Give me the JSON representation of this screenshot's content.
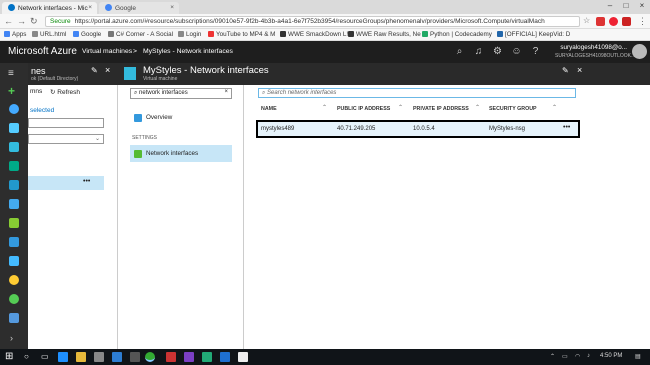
{
  "browser": {
    "tabs": [
      {
        "label": "Network interfaces - Mic",
        "active": true
      },
      {
        "label": "Google",
        "active": false
      }
    ],
    "secure_label": "Secure",
    "url": "https://portal.azure.com/#resource/subscriptions/09010e57-9f2b-4b3b-a4a1-6e7f752b3954/resourceGroups/phenomenalv/providers/Microsoft.Compute/virtualMach",
    "bookmarks": [
      "Apps",
      "URL.html",
      "Google",
      "C# Corner - A Social",
      "Login",
      "YouTube to MP4 & M",
      "WWE SmackDown L!",
      "WWE Raw Results, Ne",
      "Python | Codecademy",
      "[OFFICIAL] KeepVid: D"
    ]
  },
  "azure": {
    "logo": "Microsoft Azure",
    "breadcrumb": [
      "Virtual machines",
      ">",
      "MyStyles - Network interfaces"
    ],
    "user_name": "suryalogesh41098@o...",
    "user_dir": "SURYALOGESH41098OUTLOOK..."
  },
  "blade1": {
    "title": "nes",
    "subtitle": "ok (Default Directory)",
    "columns_label": "mns",
    "refresh_label": "Refresh",
    "selected_label": "selected",
    "more": "•••"
  },
  "blade2": {
    "search_value": "network interfaces",
    "overview_label": "Overview",
    "settings_header": "SETTINGS",
    "network_label": "Network interfaces"
  },
  "blade3": {
    "title": "MyStyles - Network interfaces",
    "subtitle": "Virtual machine",
    "search_placeholder": "Search network interfaces",
    "headers": [
      "NAME",
      "PUBLIC IP ADDRESS",
      "PRIVATE IP ADDRESS",
      "SECURITY GROUP"
    ],
    "row": {
      "name": "mystyles489",
      "public_ip": "40.71.249.205",
      "private_ip": "10.0.5.4",
      "security_group": "MyStyles-nsg",
      "more": "•••"
    }
  },
  "taskbar": {
    "time": "4:50 PM"
  },
  "colors": {
    "azure_dark": "#1e1e1e",
    "selection": "#c7e6f7",
    "accent_blue": "#0072c6"
  }
}
